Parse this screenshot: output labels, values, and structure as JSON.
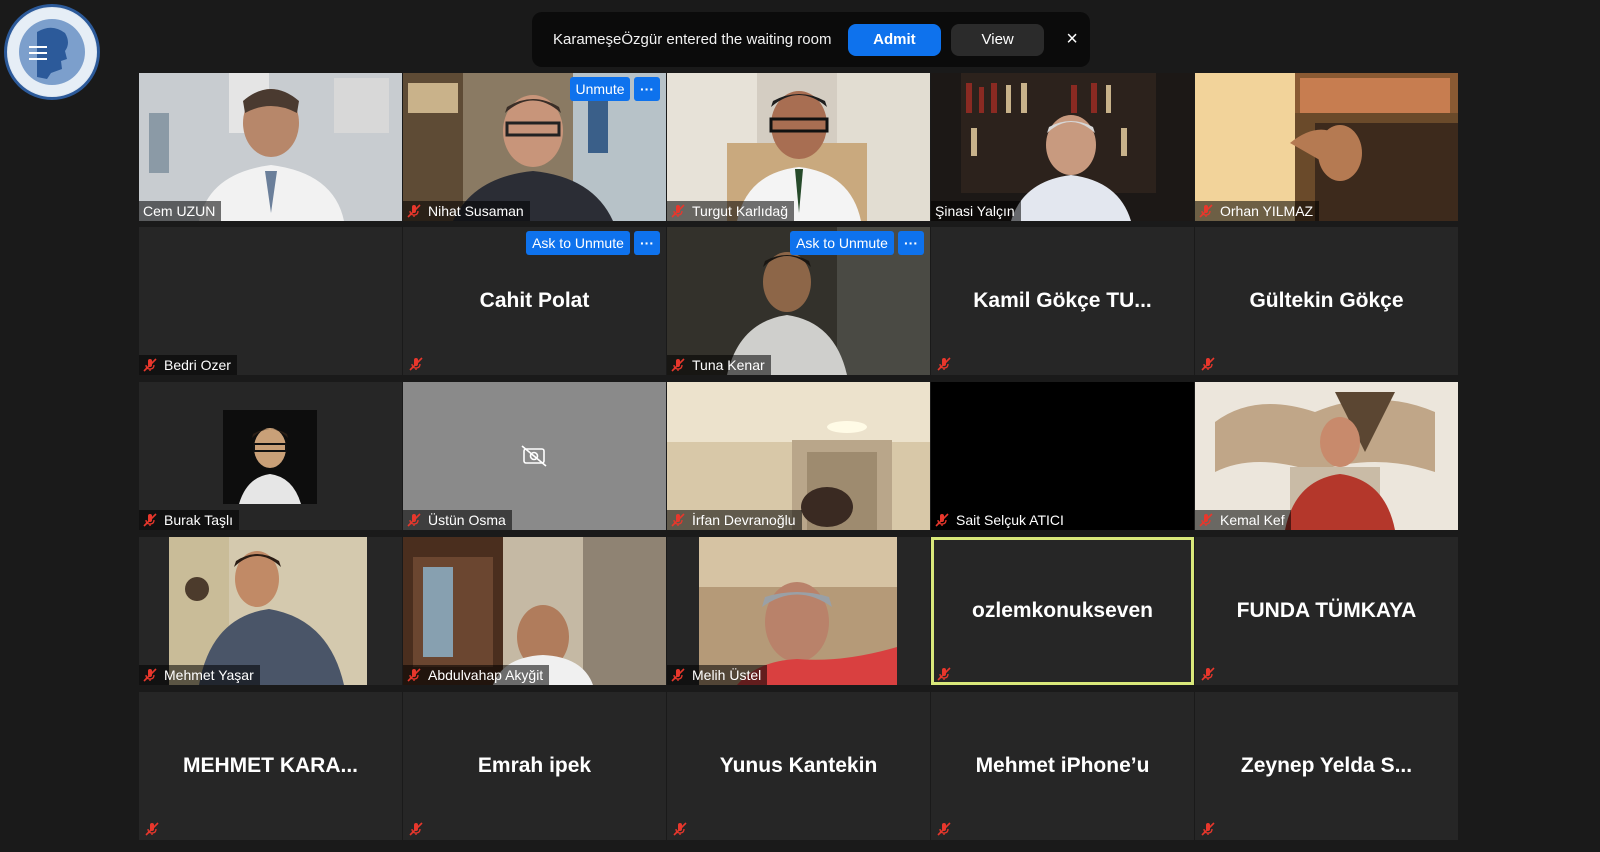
{
  "notification": {
    "text": "KarameşeÖzgür entered the waiting room",
    "admit_label": "Admit",
    "view_label": "View",
    "close_label": "×"
  },
  "participants": [
    {
      "name": "Cem UZUN",
      "mode": "video"
    },
    {
      "name": "Nihat Susaman",
      "mode": "video",
      "overlay": "Unmute"
    },
    {
      "name": "Turgut Karlıdağ",
      "mode": "video"
    },
    {
      "name": "Şinasi Yalçın",
      "mode": "video"
    },
    {
      "name": "Orhan YILMAZ",
      "mode": "video"
    },
    {
      "name": "Bedri Ozer",
      "mode": "blank"
    },
    {
      "name": "Cahit Polat",
      "mode": "name",
      "overlay": "Ask to Unmute"
    },
    {
      "name": "Tuna Kenar",
      "mode": "video",
      "overlay": "Ask to Unmute"
    },
    {
      "name": "Kamil Gökçe TU...",
      "mode": "name"
    },
    {
      "name": "Gültekin Gökçe",
      "mode": "name"
    },
    {
      "name": "Burak Taşlı",
      "mode": "video"
    },
    {
      "name": "Üstün Osma",
      "mode": "video-off"
    },
    {
      "name": "İrfan Devranoğlu",
      "mode": "video"
    },
    {
      "name": "Sait Selçuk ATICI",
      "mode": "black"
    },
    {
      "name": "Kemal Kef",
      "mode": "video"
    },
    {
      "name": "Mehmet Yaşar",
      "mode": "video"
    },
    {
      "name": "Abdulvahap Akyğit",
      "mode": "video"
    },
    {
      "name": "Melih Üstel",
      "mode": "video"
    },
    {
      "name": "ozlemkonukseven",
      "mode": "name",
      "active": true
    },
    {
      "name": "FUNDA TÜMKAYA",
      "mode": "name"
    },
    {
      "name": "MEHMET  KARA...",
      "mode": "name"
    },
    {
      "name": "Emrah ipek",
      "mode": "name"
    },
    {
      "name": "Yunus Kantekin",
      "mode": "name"
    },
    {
      "name": "Mehmet iPhone’u",
      "mode": "name"
    },
    {
      "name": "Zeynep  Yelda  S...",
      "mode": "name"
    }
  ],
  "more_label": "···",
  "colors": {
    "accent": "#0e72ed",
    "active_border": "#d9e87a",
    "muted_icon": "#e8372c",
    "tile_bg": "#262626"
  }
}
